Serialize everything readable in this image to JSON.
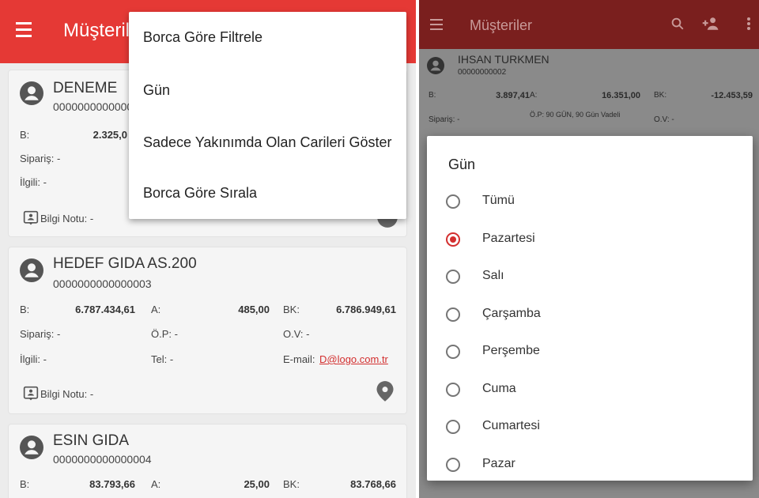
{
  "left": {
    "appbar": {
      "title": "Müşteriler"
    },
    "popup_menu": {
      "items": [
        {
          "label": "Borca Göre Filtrele"
        },
        {
          "label": "Gün"
        },
        {
          "label": "Sadece Yakınımda Olan Carileri Göster"
        },
        {
          "label": "Borca Göre Sırala"
        }
      ]
    },
    "cards": [
      {
        "name": "DENEME",
        "code": "0000000000000",
        "b_label": "B:",
        "b_value": "2.325,0",
        "siparis": "Sipariş: -",
        "ilgili": "İlgili: -",
        "note": "Bilgi Notu: -"
      },
      {
        "name": "HEDEF GIDA AS.200",
        "code": "0000000000000003",
        "b_label": "B:",
        "b_value": "6.787.434,61",
        "a_label": "A:",
        "a_value": "485,00",
        "bk_label": "BK:",
        "bk_value": "6.786.949,61",
        "siparis": "Sipariş: -",
        "op": "Ö.P: -",
        "ov": "O.V: -",
        "ilgili": "İlgili: -",
        "tel": "Tel: -",
        "email_label": "E-mail:",
        "email": "D@logo.com.tr",
        "note": "Bilgi Notu: -"
      },
      {
        "name": "ESIN GIDA",
        "code": "0000000000000004",
        "b_label": "B:",
        "b_value": "83.793,66",
        "a_label": "A:",
        "a_value": "25,00",
        "bk_label": "BK:",
        "bk_value": "83.768,66"
      }
    ]
  },
  "right": {
    "appbar": {
      "title": "Müşteriler"
    },
    "card": {
      "name": "IHSAN TURKMEN",
      "code": "00000000002",
      "b_label": "B:",
      "b_value": "3.897,41",
      "a_label": "A:",
      "a_value": "16.351,00",
      "bk_label": "BK:",
      "bk_value": "-12.453,59",
      "siparis": "Sipariş: -",
      "op": "Ö.P: 90 GÜN, 90 Gün Vadeli",
      "ov": "O.V: -"
    },
    "dialog": {
      "title": "Gün",
      "selected": "Pazartesi",
      "options": [
        {
          "label": "Tümü"
        },
        {
          "label": "Pazartesi"
        },
        {
          "label": "Salı"
        },
        {
          "label": "Çarşamba"
        },
        {
          "label": "Perşembe"
        },
        {
          "label": "Cuma"
        },
        {
          "label": "Cumartesi"
        },
        {
          "label": "Pazar"
        }
      ]
    }
  },
  "colors": {
    "primary": "#e53935",
    "primary_dimmed": "#7a1f1e",
    "accent": "#d32f2f",
    "card_bg": "#f5f5f5"
  },
  "icons": [
    "menu-icon",
    "person-icon",
    "note-icon",
    "location-pin-icon",
    "search-icon",
    "add-person-icon",
    "more-vert-icon"
  ]
}
